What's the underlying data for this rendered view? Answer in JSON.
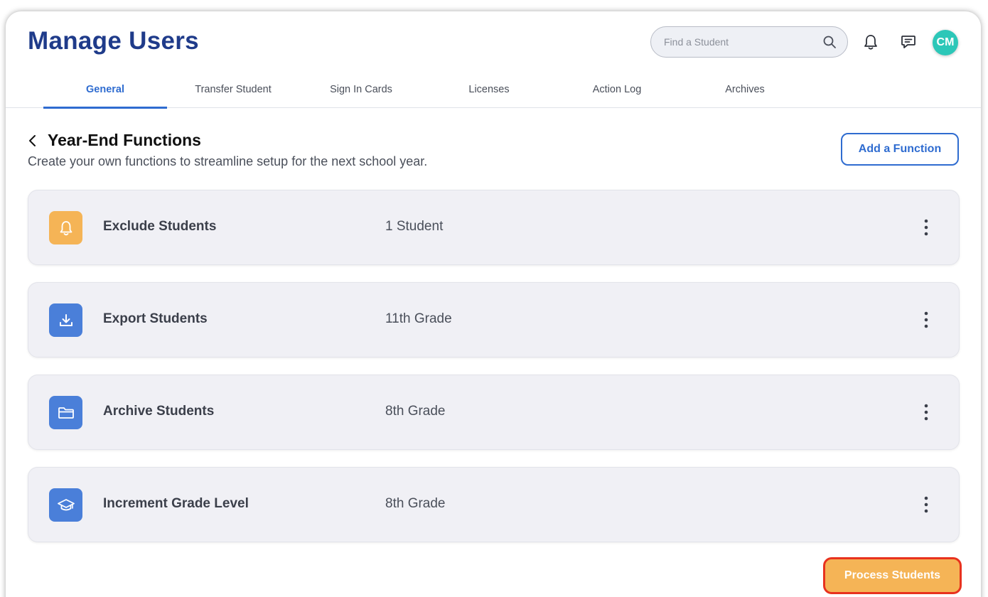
{
  "header": {
    "title": "Manage Users",
    "search_placeholder": "Find a Student",
    "avatar_initials": "CM"
  },
  "tabs": [
    {
      "label": "General",
      "active": true
    },
    {
      "label": "Transfer Student"
    },
    {
      "label": "Sign In Cards"
    },
    {
      "label": "Licenses"
    },
    {
      "label": "Action Log"
    },
    {
      "label": "Archives"
    }
  ],
  "section": {
    "title": "Year-End Functions",
    "subtitle": "Create your own functions to streamline setup for the next school year.",
    "add_button": "Add a Function"
  },
  "functions": [
    {
      "name": "Exclude Students",
      "target": "1 Student",
      "icon": "bell-icon",
      "color": "#f5b456"
    },
    {
      "name": "Export Students",
      "target": "11th Grade",
      "icon": "download-icon",
      "color": "#4a7fd9"
    },
    {
      "name": "Archive Students",
      "target": "8th Grade",
      "icon": "folder-icon",
      "color": "#4a7fd9"
    },
    {
      "name": "Increment Grade Level",
      "target": "8th Grade",
      "icon": "graduation-cap-icon",
      "color": "#4a7fd9"
    }
  ],
  "process_button": "Process Students",
  "colors": {
    "title": "#1f3b8a",
    "accent": "#2f6cd0",
    "avatar": "#2cc7b8",
    "process": "#f5b456",
    "process_border": "#e8321e"
  }
}
